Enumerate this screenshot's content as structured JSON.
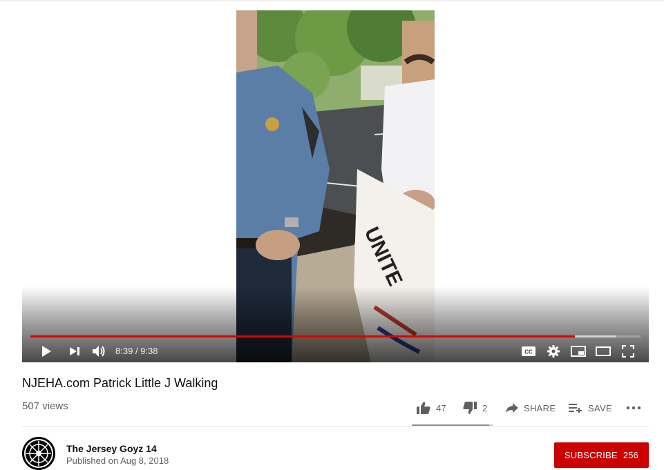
{
  "player": {
    "current_time": "8:39",
    "duration": "9:38",
    "progress_fraction": 0.892,
    "loaded_fraction": 0.96
  },
  "video": {
    "title": "NJEHA.com Patrick Little J Walking",
    "views": "507 views"
  },
  "actions": {
    "likes": "47",
    "dislikes": "2",
    "share_label": "SHARE",
    "save_label": "SAVE",
    "like_fraction": 0.96
  },
  "channel": {
    "name": "The Jersey Goyz 14",
    "published": "Published on Aug 8, 2018",
    "subscribe_label": "SUBSCRIBE",
    "subscriber_count": "256"
  },
  "colors": {
    "progress_played": "#e00000",
    "subscribe_bg": "#cc0000"
  }
}
